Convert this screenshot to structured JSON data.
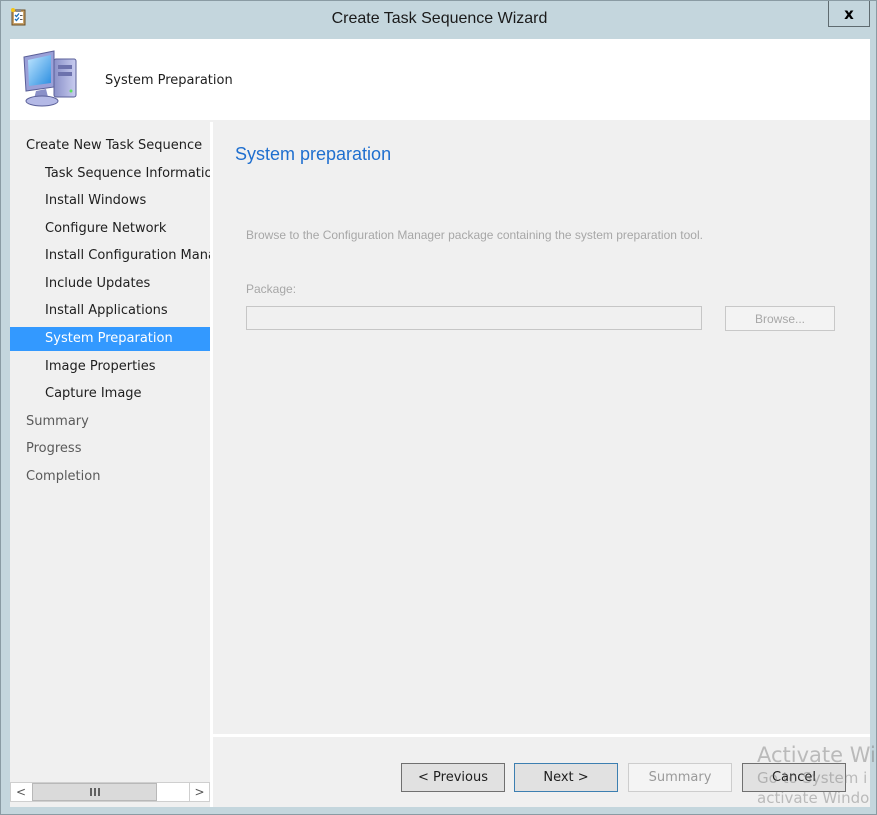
{
  "window": {
    "title": "Create Task Sequence Wizard",
    "close_label": "x",
    "icon": "task-sequence-wizard-icon"
  },
  "header": {
    "title": "System Preparation",
    "icon": "computer-icon"
  },
  "nav": {
    "items": [
      {
        "label": "Create New Task Sequence",
        "level": 0,
        "state": "normal"
      },
      {
        "label": "Task Sequence Information",
        "level": 1,
        "state": "normal"
      },
      {
        "label": "Install Windows",
        "level": 1,
        "state": "normal"
      },
      {
        "label": "Configure Network",
        "level": 1,
        "state": "normal"
      },
      {
        "label": "Install Configuration Manager",
        "level": 1,
        "state": "normal"
      },
      {
        "label": "Include Updates",
        "level": 1,
        "state": "normal"
      },
      {
        "label": "Install Applications",
        "level": 1,
        "state": "normal"
      },
      {
        "label": "System Preparation",
        "level": 1,
        "state": "selected"
      },
      {
        "label": "Image Properties",
        "level": 1,
        "state": "normal"
      },
      {
        "label": "Capture Image",
        "level": 1,
        "state": "normal"
      },
      {
        "label": "Summary",
        "level": 0,
        "state": "pending"
      },
      {
        "label": "Progress",
        "level": 0,
        "state": "pending"
      },
      {
        "label": "Completion",
        "level": 0,
        "state": "pending"
      }
    ],
    "scrollbar": {
      "left_arrow": "<",
      "right_arrow": ">",
      "thumb_position_fraction": 0.0,
      "thumb_size_fraction": 0.79
    }
  },
  "content": {
    "page_title": "System preparation",
    "description": "Browse to the Configuration Manager package containing the system preparation tool.",
    "package_label": "Package:",
    "package_value": "",
    "browse_label": "Browse..."
  },
  "footer": {
    "previous_label": "< Previous",
    "next_label": "Next >",
    "summary_label": "Summary",
    "cancel_label": "Cancel"
  },
  "watermark": {
    "line1": "Activate Wi",
    "line2": "Go to System i",
    "line3": "activate Windo"
  },
  "colors": {
    "frame": "#c4d6dd",
    "selection": "#3399ff",
    "title_accent": "#1f6fcf",
    "disabled_text": "#a7a7a7"
  }
}
